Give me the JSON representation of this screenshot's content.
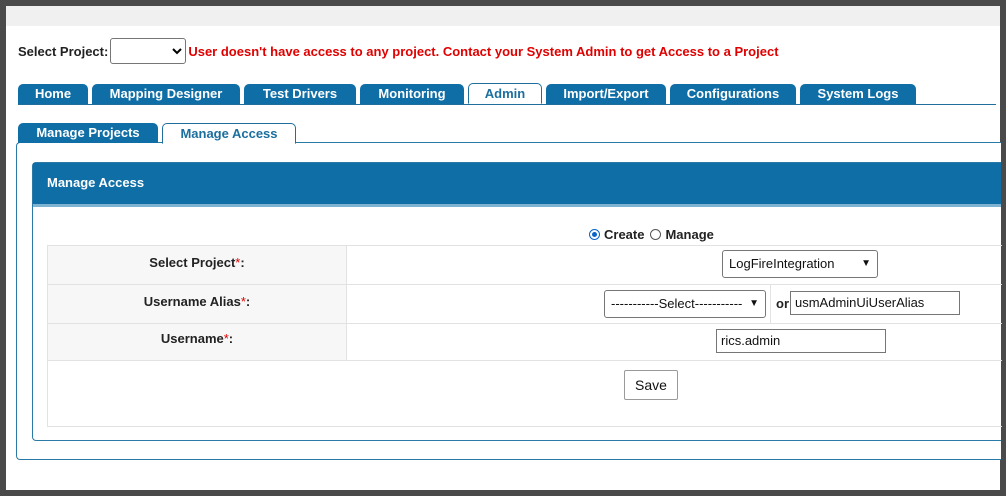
{
  "header": {
    "select_project_label": "Select Project:",
    "project_value": "",
    "error_message": "User doesn't have access to any project. Contact your System Admin to get Access to a Project"
  },
  "main_tabs": [
    {
      "label": "Home",
      "active": false
    },
    {
      "label": "Mapping Designer",
      "active": false
    },
    {
      "label": "Test Drivers",
      "active": false
    },
    {
      "label": "Monitoring",
      "active": false
    },
    {
      "label": "Admin",
      "active": true
    },
    {
      "label": "Import/Export",
      "active": false
    },
    {
      "label": "Configurations",
      "active": false
    },
    {
      "label": "System Logs",
      "active": false
    }
  ],
  "sub_tabs": [
    {
      "label": "Manage Projects",
      "active": false
    },
    {
      "label": "Manage Access",
      "active": true
    }
  ],
  "panel": {
    "title": "Manage Access",
    "mode": {
      "create_label": "Create",
      "manage_label": "Manage",
      "selected": "Create"
    },
    "fields": {
      "select_project_label": "Select Project",
      "select_project_value": "LogFireIntegration",
      "username_alias_label": "Username Alias",
      "alias_select_value": "-----------Select-----------",
      "or_label": "or",
      "alias_input_value": "usmAdminUiUserAlias",
      "username_label": "Username",
      "username_value": "rics.admin",
      "required_mark": "*",
      "colon": ":"
    },
    "save_label": "Save"
  },
  "colors": {
    "tab_blue": "#0f6ea6",
    "error_red": "#e00000"
  }
}
